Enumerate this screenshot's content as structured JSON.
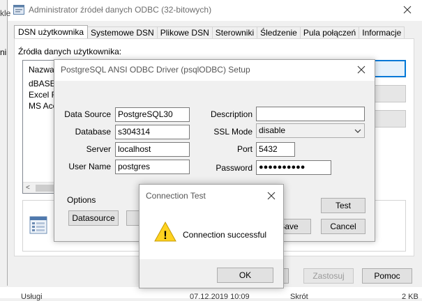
{
  "admin": {
    "title": "Administrator źródeł danych ODBC (32-bitowych)",
    "tabs": [
      {
        "label": "DSN użytkownika"
      },
      {
        "label": "Systemowe DSN"
      },
      {
        "label": "Plikowe DSN"
      },
      {
        "label": "Sterowniki"
      },
      {
        "label": "Śledzenie"
      },
      {
        "label": "Pula połączeń"
      },
      {
        "label": "Informacje"
      }
    ],
    "sources_label": "Źródła danych użytkownika:",
    "list_header": "Nazwa",
    "list_items": [
      "dBASE",
      "Excel Fi",
      "MS Acc"
    ],
    "buttons": {
      "ok_partial": "",
      "apply": "Zastosuj",
      "help": "Pomoc"
    },
    "left_edge_text": "kle",
    "left_edge_text2": "ni",
    "background_row": {
      "name": "Usługi",
      "date": "07.12.2019 10:09",
      "type": "Skrót",
      "size": "2 KB"
    }
  },
  "setup": {
    "title": "PostgreSQL ANSI ODBC Driver (psqlODBC) Setup",
    "fields": {
      "data_source": {
        "label": "Data Source",
        "value": "PostgreSQL30"
      },
      "database": {
        "label": "Database",
        "value": "s304314"
      },
      "server": {
        "label": "Server",
        "value": "localhost"
      },
      "user_name": {
        "label": "User Name",
        "value": "postgres"
      },
      "description": {
        "label": "Description",
        "value": ""
      },
      "ssl_mode": {
        "label": "SSL Mode",
        "value": "disable"
      },
      "port": {
        "label": "Port",
        "value": "5432"
      },
      "password": {
        "label": "Password",
        "value": "●●●●●●●●●●"
      }
    },
    "options_label": "Options",
    "buttons": {
      "datasource": "Datasource",
      "test": "Test",
      "save": "Save",
      "cancel": "Cancel"
    }
  },
  "connection_test": {
    "title": "Connection Test",
    "message": "Connection successful",
    "ok_label": "OK",
    "warning_glyph": "!"
  }
}
